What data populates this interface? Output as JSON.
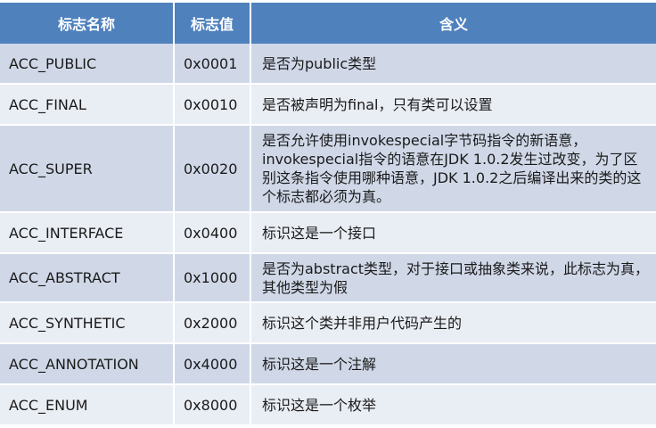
{
  "header": {
    "name": "标志名称",
    "value": "标志值",
    "meaning": "含义"
  },
  "rows": [
    {
      "name": "ACC_PUBLIC",
      "value": "0x0001",
      "meaning": "是否为public类型"
    },
    {
      "name": "ACC_FINAL",
      "value": "0x0010",
      "meaning": "是否被声明为final，只有类可以设置"
    },
    {
      "name": "ACC_SUPER",
      "value": "0x0020",
      "meaning": "是否允许使用invokespecial字节码指令的新语意，invokespecial指令的语意在JDK 1.0.2发生过改变，为了区别这条指令使用哪种语意，JDK 1.0.2之后编译出来的类的这个标志都必须为真。"
    },
    {
      "name": "ACC_INTERFACE",
      "value": "0x0400",
      "meaning": "标识这是一个接口"
    },
    {
      "name": "ACC_ABSTRACT",
      "value": "0x1000",
      "meaning": "是否为abstract类型，对于接口或抽象类来说，此标志为真，其他类型为假"
    },
    {
      "name": "ACC_SYNTHETIC",
      "value": "0x2000",
      "meaning": "标识这个类并非用户代码产生的"
    },
    {
      "name": "ACC_ANNOTATION",
      "value": "0x4000",
      "meaning": "标识这是一个注解"
    },
    {
      "name": "ACC_ENUM",
      "value": "0x8000",
      "meaning": "标识这是一个枚举"
    }
  ],
  "colors": {
    "header_bg": "#4f81bd",
    "row_odd": "#d0d8e8",
    "row_even": "#e9edf4"
  }
}
